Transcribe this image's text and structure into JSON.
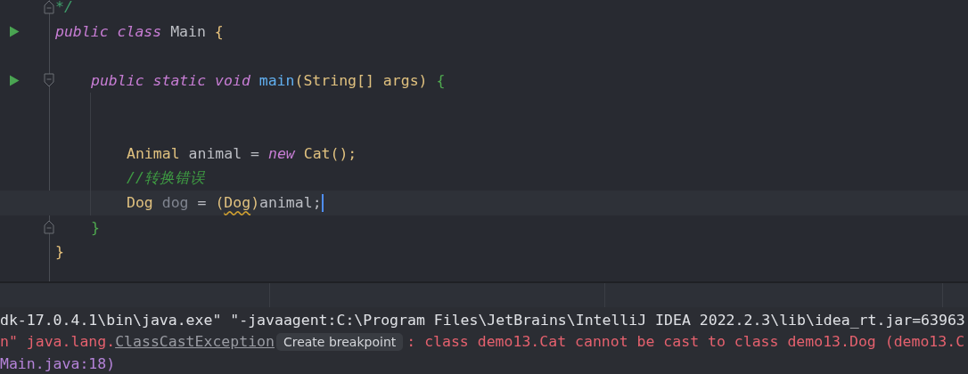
{
  "editor": {
    "lines": [
      {
        "runnable": false,
        "fold_start": false,
        "fold_end": true,
        "current": false,
        "caret": false,
        "tokens": [
          {
            "text": "*/",
            "kind": "doc_comment"
          }
        ]
      },
      {
        "runnable": true,
        "fold_start": false,
        "fold_end": false,
        "current": false,
        "caret": false,
        "tokens": [
          {
            "text": "public class ",
            "kind": "keyword"
          },
          {
            "text": "Main ",
            "kind": "plain"
          },
          {
            "text": "{",
            "kind": "brace_outer"
          }
        ],
        "children": [
          {
            "runnable": false,
            "fold_start": false,
            "fold_end": false,
            "current": false,
            "caret": false
          },
          {
            "runnable": true,
            "fold_start": true,
            "fold_end": false,
            "current": false,
            "caret": false,
            "tokens": [
              {
                "text": "public static void ",
                "kind": "keyword"
              },
              {
                "text": "main",
                "kind": "method"
              },
              {
                "text": "(String[] args) ",
                "kind": "type"
              },
              {
                "text": "{",
                "kind": "brace_inner"
              }
            ],
            "children": [
              {
                "runnable": false,
                "fold_start": false,
                "fold_end": false,
                "current": false,
                "caret": false
              },
              {
                "runnable": false,
                "fold_start": false,
                "fold_end": false,
                "current": false,
                "caret": false
              },
              {
                "runnable": false,
                "fold_start": false,
                "fold_end": false,
                "current": false,
                "caret": false,
                "tokens": [
                  {
                    "text": "Animal ",
                    "kind": "type"
                  },
                  {
                    "text": "animal = ",
                    "kind": "plain"
                  },
                  {
                    "text": "new ",
                    "kind": "keyword"
                  },
                  {
                    "text": "Cat();",
                    "kind": "type"
                  }
                ]
              },
              {
                "runnable": false,
                "fold_start": false,
                "fold_end": false,
                "current": false,
                "caret": false,
                "tokens": [
                  {
                    "text": "//转换错误",
                    "kind": "comment"
                  }
                ]
              },
              {
                "runnable": false,
                "fold_start": false,
                "fold_end": false,
                "current": true,
                "caret": true,
                "tokens": [
                  {
                    "text": "Dog ",
                    "kind": "type"
                  },
                  {
                    "text": "dog",
                    "kind": "unused"
                  },
                  {
                    "text": " = ",
                    "kind": "plain"
                  },
                  {
                    "text": "(",
                    "kind": "type"
                  },
                  {
                    "text": "Dog",
                    "kind": "warning"
                  },
                  {
                    "text": ")",
                    "kind": "type"
                  },
                  {
                    "text": "animal;",
                    "kind": "plain"
                  }
                ]
              }
            ]
          },
          {
            "runnable": false,
            "fold_start": false,
            "fold_end": true,
            "current": false,
            "caret": false,
            "tokens": [
              {
                "text": "}",
                "kind": "brace_inner"
              }
            ]
          }
        ]
      },
      {
        "runnable": false,
        "fold_start": false,
        "fold_end": false,
        "current": false,
        "caret": false,
        "tokens": [
          {
            "text": "}",
            "kind": "brace_outer"
          }
        ]
      }
    ]
  },
  "console": {
    "lines": [
      {
        "segments": [
          {
            "text": "dk-17.0.4.1\\bin\\java.exe\" \"-javaagent:C:\\Program Files\\JetBrains\\IntelliJ IDEA 2022.2.3\\lib\\idea_rt.jar=63963",
            "kind": "plain"
          }
        ]
      },
      {
        "segments": [
          {
            "text": "n\" java.lang.",
            "kind": "error"
          },
          {
            "text": "ClassCastException",
            "kind": "link"
          },
          {
            "text": "Create breakpoint",
            "kind": "chip"
          },
          {
            "text": ": class demo13.Cat cannot be cast to class demo13.Dog (demo13.C",
            "kind": "error"
          }
        ]
      },
      {
        "segments": [
          {
            "text": "Main.java:18)",
            "kind": "trace"
          }
        ]
      }
    ]
  }
}
